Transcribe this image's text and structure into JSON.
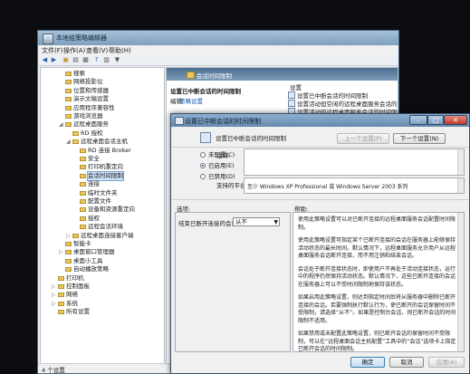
{
  "main_window": {
    "title": "本地组策略编辑器",
    "menu": [
      "文件(F)",
      "操作(A)",
      "查看(V)",
      "帮助(H)"
    ],
    "tree": [
      {
        "label": "搜索",
        "depth": 3,
        "arrow": ""
      },
      {
        "label": "网络投影仪",
        "depth": 3,
        "arrow": ""
      },
      {
        "label": "位置和传感器",
        "depth": 3,
        "arrow": ""
      },
      {
        "label": "演示文稿设置",
        "depth": 3,
        "arrow": ""
      },
      {
        "label": "应用程序兼容性",
        "depth": 3,
        "arrow": ""
      },
      {
        "label": "游戏浏览器",
        "depth": 3,
        "arrow": ""
      },
      {
        "label": "远程桌面服务",
        "depth": 3,
        "arrow": "◢"
      },
      {
        "label": "RD 授权",
        "depth": 4,
        "arrow": ""
      },
      {
        "label": "远程桌面会话主机",
        "depth": 4,
        "arrow": "◢"
      },
      {
        "label": "RD 连接 Broker",
        "depth": 5,
        "arrow": ""
      },
      {
        "label": "安全",
        "depth": 5,
        "arrow": ""
      },
      {
        "label": "打印机重定向",
        "depth": 5,
        "arrow": ""
      },
      {
        "label": "会话时间限制",
        "depth": 5,
        "arrow": "",
        "selected": true
      },
      {
        "label": "连接",
        "depth": 5,
        "arrow": ""
      },
      {
        "label": "临时文件夹",
        "depth": 5,
        "arrow": ""
      },
      {
        "label": "配置文件",
        "depth": 5,
        "arrow": ""
      },
      {
        "label": "设备和资源重定向",
        "depth": 5,
        "arrow": ""
      },
      {
        "label": "授权",
        "depth": 5,
        "arrow": ""
      },
      {
        "label": "远程会话环境",
        "depth": 5,
        "arrow": ""
      },
      {
        "label": "远程桌面连接客户端",
        "depth": 4,
        "arrow": "▷"
      },
      {
        "label": "智能卡",
        "depth": 3,
        "arrow": ""
      },
      {
        "label": "桌面窗口管理器",
        "depth": 3,
        "arrow": "▷"
      },
      {
        "label": "桌面小工具",
        "depth": 3,
        "arrow": ""
      },
      {
        "label": "自动播放策略",
        "depth": 3,
        "arrow": ""
      },
      {
        "label": "打印机",
        "depth": 2,
        "arrow": ""
      },
      {
        "label": "控制面板",
        "depth": 2,
        "arrow": "▷"
      },
      {
        "label": "网络",
        "depth": 2,
        "arrow": "▷"
      },
      {
        "label": "系统",
        "depth": 2,
        "arrow": "▷"
      },
      {
        "label": "所有设置",
        "depth": 2,
        "arrow": ""
      }
    ],
    "right_header": "会话时间限制",
    "right_title": "设置已中断会话的时间限制",
    "edit_prefix": "编辑",
    "edit_link": "策略设置",
    "right_list_header": "设置",
    "right_list": [
      "设置已中断会话的时间限制",
      "设置活动但空闲的远程桌面服务会话的时间限制",
      "设置活动的远程桌面服务会话的时间限制"
    ],
    "status": "4 个设置"
  },
  "dialog": {
    "title": "设置已中断会话的时间限制",
    "setting_name": "设置已中断会话的时间限制",
    "prev_button": "上一个设置(P)",
    "next_button": "下一个设置(N)",
    "radios": [
      "未配置(C)",
      "已启用(E)",
      "已禁用(D)"
    ],
    "selected_radio": 1,
    "comment_label": "注释:",
    "supported_label": "支持的平台:",
    "supported_value": "至少 Windows XP Professional 或 Windows Server 2003 系列",
    "options_label": "选项:",
    "help_label": "帮助:",
    "option_field_label": "结束已断开连接的会话",
    "option_value": "从不",
    "help_text": [
      "使用此策略设置可以对已断开连接的远程桌面服务会话配置时间限制。",
      "使用此策略设置可指定某个已断开连接的会话在服务器上能够保持活动状态的最长时间。默认情况下，远程桌面服务允许用户从远程桌面服务会话断开连接，而不用注销和结束会话。",
      "会话处于断开连接状态时，即使用户不再处于活动连接状态，运行中的程序仍然保持活动状态。默认情况下，这些已断开连接的会话在服务器上可以不受时间限制地保持该状态。",
      "如果启用此策略设置，则达到指定时间后将从服务器中删除已断开连接的会话。若要强制执行默认行为，使已断开的会话保留时间不受限制，请选择“从不”。如果是控制台会话，则已断开会话的时间限制不适用。",
      "如果禁用或未配置此策略设置，则已断开会话的保留时间不受限制，可以在“远程桌面会话主机配置”工具中的“会话”选项卡上指定已断开会话的时间限制。"
    ],
    "ok": "确定",
    "cancel": "取消",
    "apply": "应用(A)"
  },
  "colors": {
    "accent": "#2a6fc6",
    "title_gradient": "#7e9fbf"
  }
}
